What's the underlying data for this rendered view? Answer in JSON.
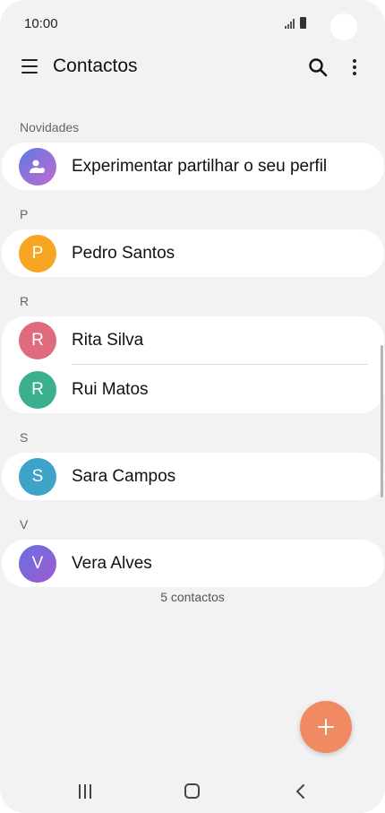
{
  "status_bar": {
    "time": "10:00"
  },
  "app_bar": {
    "title": "Contactos"
  },
  "sections": [
    {
      "label": "Novidades"
    },
    {
      "label": "P"
    },
    {
      "label": "R"
    },
    {
      "label": "S"
    },
    {
      "label": "V"
    }
  ],
  "profile_share": {
    "label": "Experimentar partilhar o seu perfil",
    "color": "#8a63d2"
  },
  "contacts": [
    {
      "initial": "P",
      "name": "Pedro Santos",
      "color": "#f6a623"
    },
    {
      "initial": "R",
      "name": "Rita Silva",
      "color": "#e06a7e"
    },
    {
      "initial": "R",
      "name": "Rui Matos",
      "color": "#3bb08f"
    },
    {
      "initial": "S",
      "name": "Sara Campos",
      "color": "#3ea3c8"
    },
    {
      "initial": "V",
      "name": "Vera Alves",
      "color": "#7b62d6"
    }
  ],
  "footer": {
    "count": "5 contactos"
  },
  "fab": {
    "icon": "plus-icon",
    "color": "#ef8a62"
  },
  "nav": {
    "recent": "recent-apps-icon",
    "home": "home-icon",
    "back": "back-icon"
  }
}
